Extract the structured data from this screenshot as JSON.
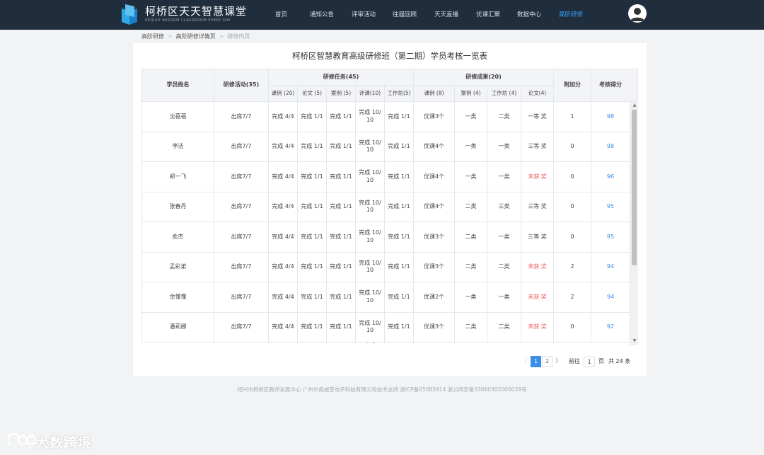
{
  "header": {
    "site_title": "柯桥区天天智慧课堂",
    "site_subtitle": "KEQIAO WISDOM CLASSROOM EVERY DAY",
    "nav": [
      "首页",
      "通知公告",
      "评审活动",
      "往届回顾",
      "天天直播",
      "优课汇聚",
      "数据中心",
      "高阶研修"
    ],
    "active_nav": "高阶研修"
  },
  "breadcrumb": [
    "高阶研修",
    "高阶研修详情页",
    "研修内页"
  ],
  "page_title": "柯桥区智慧教育高级研修班（第二期）学员考核一览表",
  "table": {
    "headers": {
      "name": "学员姓名",
      "activity": "研修活动(35)",
      "tasks": "研修任务(45)",
      "results": "研修成果(20)",
      "bonus": "附加分",
      "score": "考核得分"
    },
    "task_cols": [
      "课例 (20)",
      "论文 (5)",
      "案例 (5)",
      "评课(10)",
      "工作坊(5)"
    ],
    "result_cols": [
      "课例 (8)",
      "案例 (4)",
      "工作坊 (4)",
      "论文(4)"
    ],
    "rows": [
      {
        "name": "沈蓓蓓",
        "activity": "出席7/7",
        "t1": "完成 4/4",
        "t2": "完成 1/1",
        "t3": "完成 1/1",
        "t4": "完成 10/ 10",
        "t5": "完成 1/1",
        "r1": "优课3个",
        "r2": "一类",
        "r3": "二类",
        "r4": "一等 奖",
        "bonus": "1",
        "score": "98"
      },
      {
        "name": "李洁",
        "activity": "出席7/7",
        "t1": "完成 4/4",
        "t2": "完成 1/1",
        "t3": "完成 1/1",
        "t4": "完成 10/ 10",
        "t5": "完成 1/1",
        "r1": "优课4个",
        "r2": "一类",
        "r3": "一类",
        "r4": "三等 奖",
        "bonus": "0",
        "score": "98"
      },
      {
        "name": "郑一飞",
        "activity": "出席7/7",
        "t1": "完成 4/4",
        "t2": "完成 1/1",
        "t3": "完成 1/1",
        "t4": "完成 10/ 10",
        "t5": "完成 1/1",
        "r1": "优课4个",
        "r2": "一类",
        "r3": "一类",
        "r4": "未获 奖",
        "bonus": "0",
        "score": "96"
      },
      {
        "name": "张春丹",
        "activity": "出席7/7",
        "t1": "完成 4/4",
        "t2": "完成 1/1",
        "t3": "完成 1/1",
        "t4": "完成 10/ 10",
        "t5": "完成 1/1",
        "r1": "优课4个",
        "r2": "二类",
        "r3": "三类",
        "r4": "三等 奖",
        "bonus": "0",
        "score": "95"
      },
      {
        "name": "俞杰",
        "activity": "出席7/7",
        "t1": "完成 4/4",
        "t2": "完成 1/1",
        "t3": "完成 1/1",
        "t4": "完成 10/ 10",
        "t5": "完成 1/1",
        "r1": "优课3个",
        "r2": "二类",
        "r3": "一类",
        "r4": "三等 奖",
        "bonus": "0",
        "score": "95"
      },
      {
        "name": "孟彩弟",
        "activity": "出席7/7",
        "t1": "完成 4/4",
        "t2": "完成 1/1",
        "t3": "完成 1/1",
        "t4": "完成 10/ 10",
        "t5": "完成 1/1",
        "r1": "优课3个",
        "r2": "二类",
        "r3": "二类",
        "r4": "未获 奖",
        "bonus": "2",
        "score": "94"
      },
      {
        "name": "余懂懂",
        "activity": "出席7/7",
        "t1": "完成 4/4",
        "t2": "完成 1/1",
        "t3": "完成 1/1",
        "t4": "完成 10/ 10",
        "t5": "完成 1/1",
        "r1": "优课2个",
        "r2": "一类",
        "r3": "一类",
        "r4": "未获 奖",
        "bonus": "2",
        "score": "94"
      },
      {
        "name": "潘莉娜",
        "activity": "出席7/7",
        "t1": "完成 4/4",
        "t2": "完成 1/1",
        "t3": "完成 1/1",
        "t4": "完成 10/ 10",
        "t5": "完成 1/1",
        "r1": "优课3个",
        "r2": "二类",
        "r3": "二类",
        "r4": "未获 奖",
        "bonus": "0",
        "score": "92"
      }
    ],
    "partial_row": {
      "t4": "完成"
    }
  },
  "pagination": {
    "prev": "〈",
    "pages": [
      "1",
      "2"
    ],
    "current": "1",
    "next": "〉",
    "goto_label": "前往",
    "goto_value": "1",
    "page_unit": "页",
    "total": "共 24 条"
  },
  "footer": "绍兴市柯桥区教师发展中心 广州市奥威亚电子科技有限公司技术支持 浙ICP备05083914 浙公网安备33060302000039号",
  "watermark": "大数跨境",
  "colors": {
    "header_bg": "#1f2d3d",
    "accent": "#3a8ee6",
    "warn": "#f25a5a"
  }
}
